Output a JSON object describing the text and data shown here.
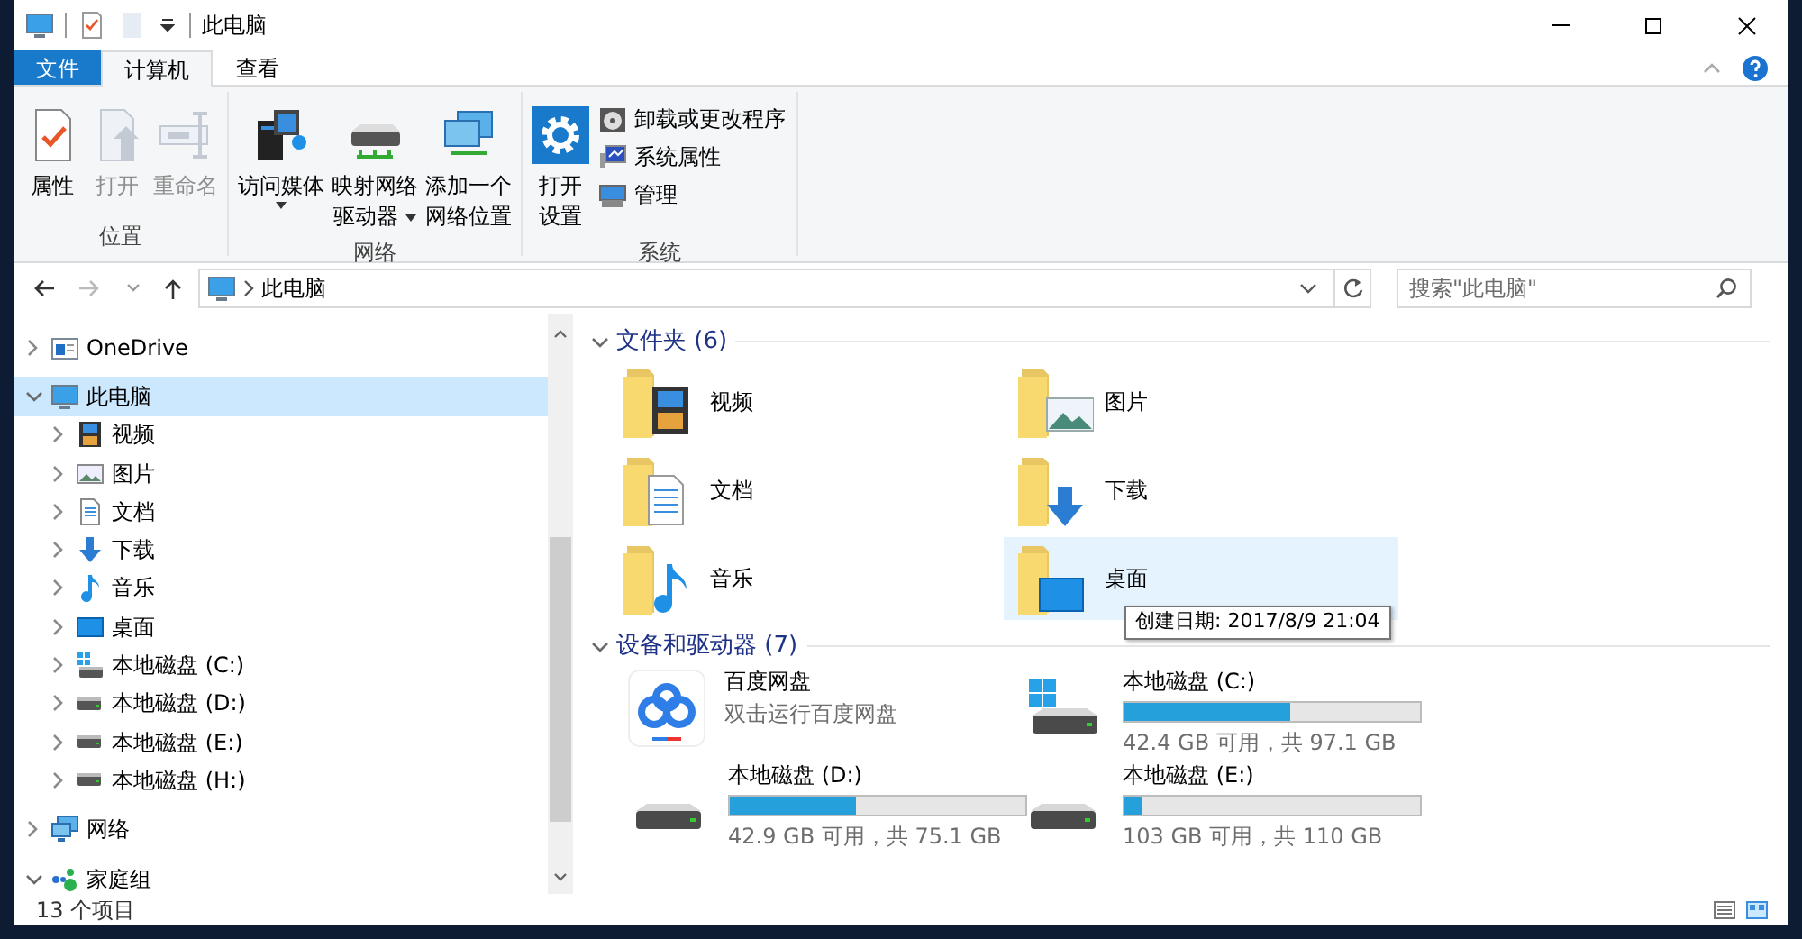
{
  "window": {
    "title": "此电脑"
  },
  "ribbon": {
    "file_tab": "文件",
    "tabs": [
      {
        "label": "计算机",
        "selected": true
      },
      {
        "label": "查看",
        "selected": false
      }
    ],
    "groups": [
      {
        "label": "位置",
        "buttons": [
          {
            "lines": [
              "属性"
            ],
            "kind": "properties",
            "disabled": false,
            "dropdown": false
          },
          {
            "lines": [
              "打开"
            ],
            "kind": "open",
            "disabled": true,
            "dropdown": false
          },
          {
            "lines": [
              "重命名"
            ],
            "kind": "rename",
            "disabled": true,
            "dropdown": false
          }
        ]
      },
      {
        "label": "网络",
        "buttons": [
          {
            "lines": [
              "访问媒体"
            ],
            "kind": "media",
            "disabled": false,
            "dropdown": true
          },
          {
            "lines": [
              "映射网络",
              "驱动器"
            ],
            "kind": "mapdrive",
            "disabled": false,
            "dropdown": true
          },
          {
            "lines": [
              "添加一个",
              "网络位置"
            ],
            "kind": "netloc",
            "disabled": false,
            "dropdown": false
          }
        ]
      },
      {
        "label": "系统",
        "buttons": [
          {
            "lines": [
              "打开",
              "设置"
            ],
            "kind": "settings",
            "disabled": false,
            "dropdown": false
          }
        ],
        "small_buttons": [
          {
            "label": "卸载或更改程序",
            "kind": "uninstall"
          },
          {
            "label": "系统属性",
            "kind": "sysprops"
          },
          {
            "label": "管理",
            "kind": "manage"
          }
        ]
      }
    ]
  },
  "address": {
    "location": "此电脑",
    "search_placeholder": "搜索\"此电脑\""
  },
  "nav": [
    {
      "label": "OneDrive",
      "kind": "onedrive",
      "expanded": false,
      "selected": false
    },
    {
      "label": "此电脑",
      "kind": "pc",
      "expanded": true,
      "selected": true,
      "children": [
        {
          "label": "视频",
          "kind": "videos",
          "expanded": false,
          "selected": false
        },
        {
          "label": "图片",
          "kind": "pictures",
          "expanded": false,
          "selected": false
        },
        {
          "label": "文档",
          "kind": "documents",
          "expanded": false,
          "selected": false
        },
        {
          "label": "下载",
          "kind": "downloads",
          "expanded": false,
          "selected": false
        },
        {
          "label": "音乐",
          "kind": "music",
          "expanded": false,
          "selected": false
        },
        {
          "label": "桌面",
          "kind": "desktop",
          "expanded": false,
          "selected": false
        },
        {
          "label": "本地磁盘 (C:)",
          "kind": "systemdrive",
          "expanded": false,
          "selected": false
        },
        {
          "label": "本地磁盘 (D:)",
          "kind": "drive",
          "expanded": false,
          "selected": false
        },
        {
          "label": "本地磁盘 (E:)",
          "kind": "drive",
          "expanded": false,
          "selected": false
        },
        {
          "label": "本地磁盘 (H:)",
          "kind": "drive",
          "expanded": false,
          "selected": false
        }
      ]
    },
    {
      "label": "网络",
      "kind": "network",
      "expanded": false,
      "selected": false
    },
    {
      "label": "家庭组",
      "kind": "homegroup",
      "expanded": true,
      "selected": false
    }
  ],
  "sections": [
    {
      "title": "文件夹 (6)",
      "expanded": true,
      "items": [
        {
          "kind": "videos",
          "name": "视频",
          "hovered": false
        },
        {
          "kind": "pictures",
          "name": "图片",
          "hovered": false
        },
        {
          "kind": "documents",
          "name": "文档",
          "hovered": false
        },
        {
          "kind": "downloads",
          "name": "下载",
          "hovered": false
        },
        {
          "kind": "music",
          "name": "音乐",
          "hovered": false
        },
        {
          "kind": "desktop",
          "name": "桌面",
          "hovered": true
        }
      ]
    },
    {
      "title": "设备和驱动器 (7)",
      "expanded": true,
      "items": [
        {
          "kind": "app",
          "name": "百度网盘",
          "subtitle": "双击运行百度网盘"
        },
        {
          "kind": "systemdrive",
          "name": "本地磁盘 (C:)",
          "level": 0.563,
          "info": "42.4 GB 可用，共 97.1 GB"
        },
        {
          "kind": "drive",
          "name": "本地磁盘 (D:)",
          "level": 0.429,
          "info": "42.9 GB 可用，共 75.1 GB"
        },
        {
          "kind": "drive",
          "name": "本地磁盘 (E:)",
          "level": 0.064,
          "info": "103 GB 可用，共 110 GB"
        }
      ]
    }
  ],
  "tooltip": "创建日期: 2017/8/9 21:04",
  "status_bar": {
    "item_count": "13 个项目"
  }
}
